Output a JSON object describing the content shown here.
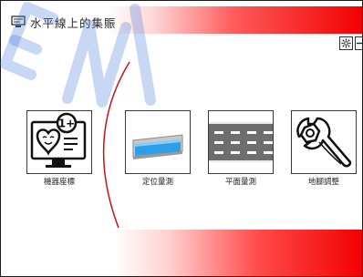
{
  "window": {
    "title": "水平線上的集賑",
    "icon": "monitor-icon"
  },
  "toolbar": {
    "settings_icon": "gear-icon",
    "minimize_icon": "minus-icon"
  },
  "tiles": [
    {
      "label": "機器座標",
      "icon": "heart-monitor-icon"
    },
    {
      "label": "定位量測",
      "icon": "level-gauge-icon"
    },
    {
      "label": "平面量測",
      "icon": "road-lanes-icon"
    },
    {
      "label": "地腳調整",
      "icon": "wrench-icon"
    }
  ],
  "accent": {
    "red": "#f20000",
    "arc": "#cc1111",
    "watermark": "#3b6fd6"
  },
  "watermark_text": "eN"
}
